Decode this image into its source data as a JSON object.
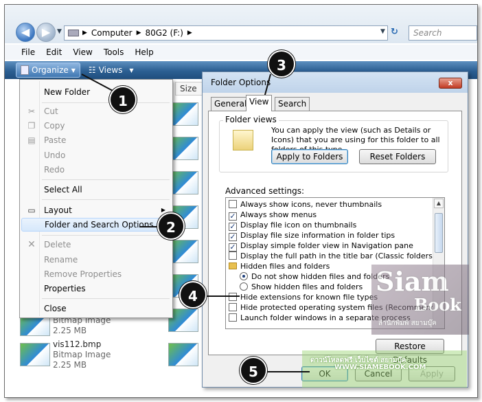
{
  "explorer": {
    "path": {
      "computer": "Computer",
      "drive": "80G2 (F:)"
    },
    "search_placeholder": "Search",
    "menu": [
      "File",
      "Edit",
      "View",
      "Tools",
      "Help"
    ],
    "toolbar": {
      "organize": "Organize",
      "views": "Views"
    },
    "column_size": "Size",
    "files": [
      {
        "name": "",
        "type": "Bitmap Image",
        "size": "2.25 MB"
      },
      {
        "name": "vis112.bmp",
        "type": "Bitmap Image",
        "size": "2.25 MB"
      }
    ]
  },
  "organize_menu": {
    "items": [
      {
        "label": "New Folder",
        "state": "enabled"
      },
      {
        "label": "Cut",
        "state": "disabled"
      },
      {
        "label": "Copy",
        "state": "disabled"
      },
      {
        "label": "Paste",
        "state": "disabled"
      },
      {
        "label": "Undo",
        "state": "disabled"
      },
      {
        "label": "Redo",
        "state": "disabled"
      },
      {
        "label": "Select All",
        "state": "enabled"
      },
      {
        "label": "Layout",
        "state": "enabled"
      },
      {
        "label": "Folder and Search Options",
        "state": "highlighted"
      },
      {
        "label": "Delete",
        "state": "disabled"
      },
      {
        "label": "Rename",
        "state": "disabled"
      },
      {
        "label": "Remove Properties",
        "state": "disabled"
      },
      {
        "label": "Properties",
        "state": "enabled"
      },
      {
        "label": "Close",
        "state": "enabled"
      }
    ]
  },
  "dialog": {
    "title": "Folder Options",
    "close": "x",
    "tabs": [
      "General",
      "View",
      "Search"
    ],
    "active_tab": "View",
    "folder_views": {
      "heading": "Folder views",
      "description": "You can apply the view (such as Details or Icons) that you are using for this folder to all folders of this type.",
      "apply_button": "Apply to Folders",
      "reset_button": "Reset Folders"
    },
    "advanced_label": "Advanced settings:",
    "settings": [
      {
        "kind": "checkbox",
        "label": "Always show icons, never thumbnails",
        "checked": false
      },
      {
        "kind": "checkbox",
        "label": "Always show menus",
        "checked": true
      },
      {
        "kind": "checkbox",
        "label": "Display file icon on thumbnails",
        "checked": true
      },
      {
        "kind": "checkbox",
        "label": "Display file size information in folder tips",
        "checked": true
      },
      {
        "kind": "checkbox",
        "label": "Display simple folder view in Navigation pane",
        "checked": true
      },
      {
        "kind": "checkbox",
        "label": "Display the full path in the title bar (Classic folders only)",
        "checked": false
      },
      {
        "kind": "folder",
        "label": "Hidden files and folders"
      },
      {
        "kind": "radio",
        "label": "Do not show hidden files and folders",
        "checked": true
      },
      {
        "kind": "radio",
        "label": "Show hidden files and folders",
        "checked": false
      },
      {
        "kind": "checkbox",
        "label": "Hide extensions for known file types",
        "checked": false
      },
      {
        "kind": "checkbox",
        "label": "Hide protected operating system files (Recommended)",
        "checked": false
      },
      {
        "kind": "checkbox",
        "label": "Launch folder windows in a separate process",
        "checked": false
      }
    ],
    "restore_button": "Restore Defaults",
    "ok": "OK",
    "cancel": "Cancel",
    "apply": "Apply"
  },
  "callouts": [
    "1",
    "2",
    "3",
    "4",
    "5"
  ],
  "watermark": {
    "line1": "Siam",
    "line2": "Book",
    "thai": "สำนักพิมพ์ สยามบุ๊ค",
    "band": "ดาวน์โหลดฟรี เว็บไซต์ สยามบุ๊ค",
    "url": "WWW.SIAMEBOOK.COM"
  }
}
